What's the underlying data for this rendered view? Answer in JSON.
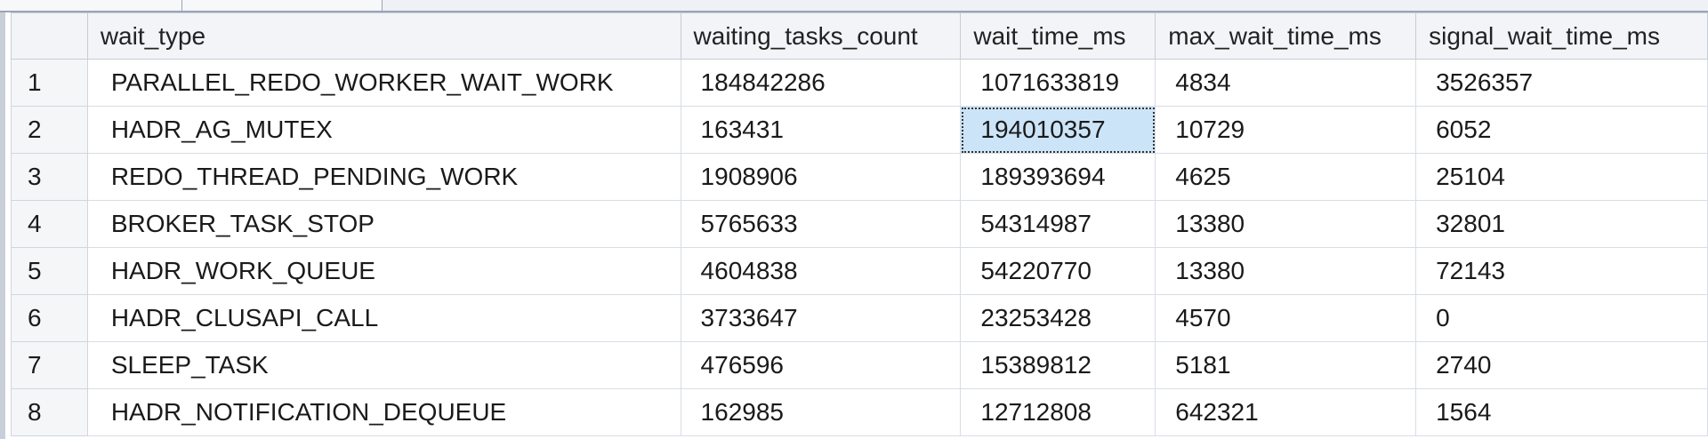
{
  "grid": {
    "columns": [
      "",
      "wait_type",
      "waiting_tasks_count",
      "wait_time_ms",
      "max_wait_time_ms",
      "signal_wait_time_ms"
    ],
    "rows": [
      {
        "n": "1",
        "wait_type": "PARALLEL_REDO_WORKER_WAIT_WORK",
        "waiting_tasks_count": "184842286",
        "wait_time_ms": "1071633819",
        "max_wait_time_ms": "4834",
        "signal_wait_time_ms": "3526357"
      },
      {
        "n": "2",
        "wait_type": "HADR_AG_MUTEX",
        "waiting_tasks_count": "163431",
        "wait_time_ms": "194010357",
        "max_wait_time_ms": "10729",
        "signal_wait_time_ms": "6052"
      },
      {
        "n": "3",
        "wait_type": "REDO_THREAD_PENDING_WORK",
        "waiting_tasks_count": "1908906",
        "wait_time_ms": "189393694",
        "max_wait_time_ms": "4625",
        "signal_wait_time_ms": "25104"
      },
      {
        "n": "4",
        "wait_type": "BROKER_TASK_STOP",
        "waiting_tasks_count": "5765633",
        "wait_time_ms": "54314987",
        "max_wait_time_ms": "13380",
        "signal_wait_time_ms": "32801"
      },
      {
        "n": "5",
        "wait_type": "HADR_WORK_QUEUE",
        "waiting_tasks_count": "4604838",
        "wait_time_ms": "54220770",
        "max_wait_time_ms": "13380",
        "signal_wait_time_ms": "72143"
      },
      {
        "n": "6",
        "wait_type": "HADR_CLUSAPI_CALL",
        "waiting_tasks_count": "3733647",
        "wait_time_ms": "23253428",
        "max_wait_time_ms": "4570",
        "signal_wait_time_ms": "0"
      },
      {
        "n": "7",
        "wait_type": "SLEEP_TASK",
        "waiting_tasks_count": "476596",
        "wait_time_ms": "15389812",
        "max_wait_time_ms": "5181",
        "signal_wait_time_ms": "2740"
      },
      {
        "n": "8",
        "wait_type": "HADR_NOTIFICATION_DEQUEUE",
        "waiting_tasks_count": "162985",
        "wait_time_ms": "12712808",
        "max_wait_time_ms": "642321",
        "signal_wait_time_ms": "1564"
      }
    ],
    "selected_cell": {
      "row": 2,
      "column": "wait_time_ms"
    }
  },
  "colors": {
    "selection": "#cce4f7",
    "header_bg": "#f2f4f7",
    "gridline": "#d8dde6"
  }
}
